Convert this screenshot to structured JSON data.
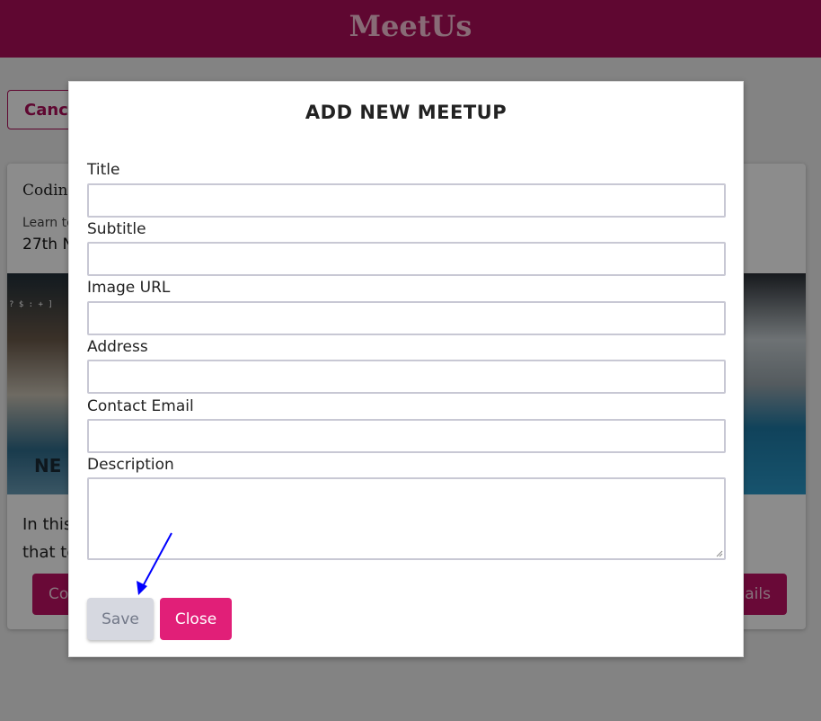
{
  "app": {
    "title": "MeetUs",
    "brand_color": "#ad0e59"
  },
  "background": {
    "cancel_label": "Cance",
    "card": {
      "title": "Codin",
      "subtitle": "Learn to",
      "date": "27th N",
      "image_text_left": "? $ : + ]",
      "image_text_sign": "NE",
      "body_line1": "In this",
      "body_line2": "that to",
      "button_left_label": "Co",
      "button_right_label": "ails"
    }
  },
  "modal": {
    "title": "ADD NEW MEETUP",
    "fields": {
      "title": {
        "label": "Title",
        "value": ""
      },
      "subtitle": {
        "label": "Subtitle",
        "value": ""
      },
      "image_url": {
        "label": "Image URL",
        "value": ""
      },
      "address": {
        "label": "Address",
        "value": ""
      },
      "contact_email": {
        "label": "Contact Email",
        "value": ""
      },
      "description": {
        "label": "Description",
        "value": ""
      }
    },
    "save_label": "Save",
    "close_label": "Close",
    "save_state": "disabled"
  },
  "annotation": {
    "arrow_color": "#0000ff",
    "icon": "arrow-icon"
  }
}
